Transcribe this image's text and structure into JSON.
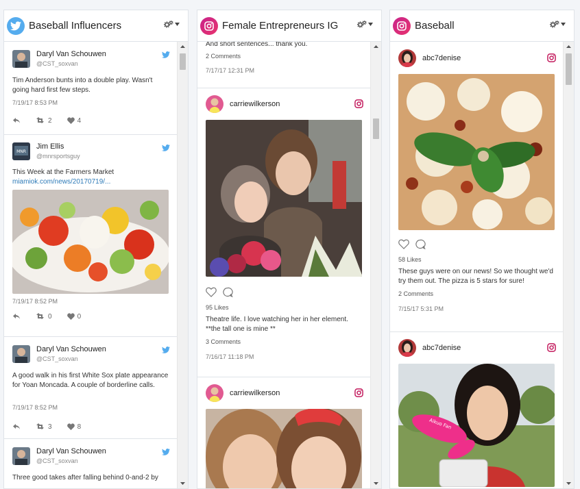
{
  "columns": [
    {
      "title": "Baseball Influencers",
      "network": "twitter",
      "posts": [
        {
          "name": "Daryl Van Schouwen",
          "handle": "@CST_soxvan",
          "text": "Tim Anderson bunts into a double play. Wasn't going hard first few steps.",
          "time": "7/19/17 8:53 PM",
          "retweets": "2",
          "likes": "4"
        },
        {
          "name": "Jim Ellis",
          "handle": "@mnrsportsguy",
          "text": "This Week at the Farmers Market",
          "link": "miamiok.com/news/20170719/...",
          "time": "7/19/17 8:52 PM",
          "retweets": "0",
          "likes": "0"
        },
        {
          "name": "Daryl Van Schouwen",
          "handle": "@CST_soxvan",
          "text": "A good walk in his first White Sox plate appearance for Yoan Moncada. A couple of borderline calls.",
          "time": "7/19/17 8:52 PM",
          "retweets": "3",
          "likes": "8"
        },
        {
          "name": "Daryl Van Schouwen",
          "handle": "@CST_soxvan",
          "text": "Three good takes after falling behind 0-and-2 by"
        }
      ]
    },
    {
      "title": "Female Entrepreneurs IG",
      "network": "instagram",
      "posts": [
        {
          "text": "And short sentences... thank you.",
          "comments": "2 Comments",
          "time": "7/17/17 12:31 PM"
        },
        {
          "name": "carriewilkerson",
          "likes": "95 Likes",
          "text": "Theatre life. I love watching her in her element. **the tall one is mine **",
          "comments": "3 Comments",
          "time": "7/16/17 11:18 PM"
        },
        {
          "name": "carriewilkerson"
        }
      ]
    },
    {
      "title": "Baseball",
      "network": "instagram",
      "posts": [
        {
          "name": "abc7denise",
          "likes": "58 Likes",
          "text": "These guys were on our news! So we thought we'd try them out. The pizza is 5 stars for sure!",
          "comments": "2 Comments",
          "time": "7/15/17 5:31 PM"
        },
        {
          "name": "abc7denise",
          "fan_text": "Aikuo Fan"
        }
      ]
    }
  ],
  "colors": {
    "twitter": "#55acee",
    "instagram": "#e0245e",
    "link": "#2e7bb8"
  }
}
